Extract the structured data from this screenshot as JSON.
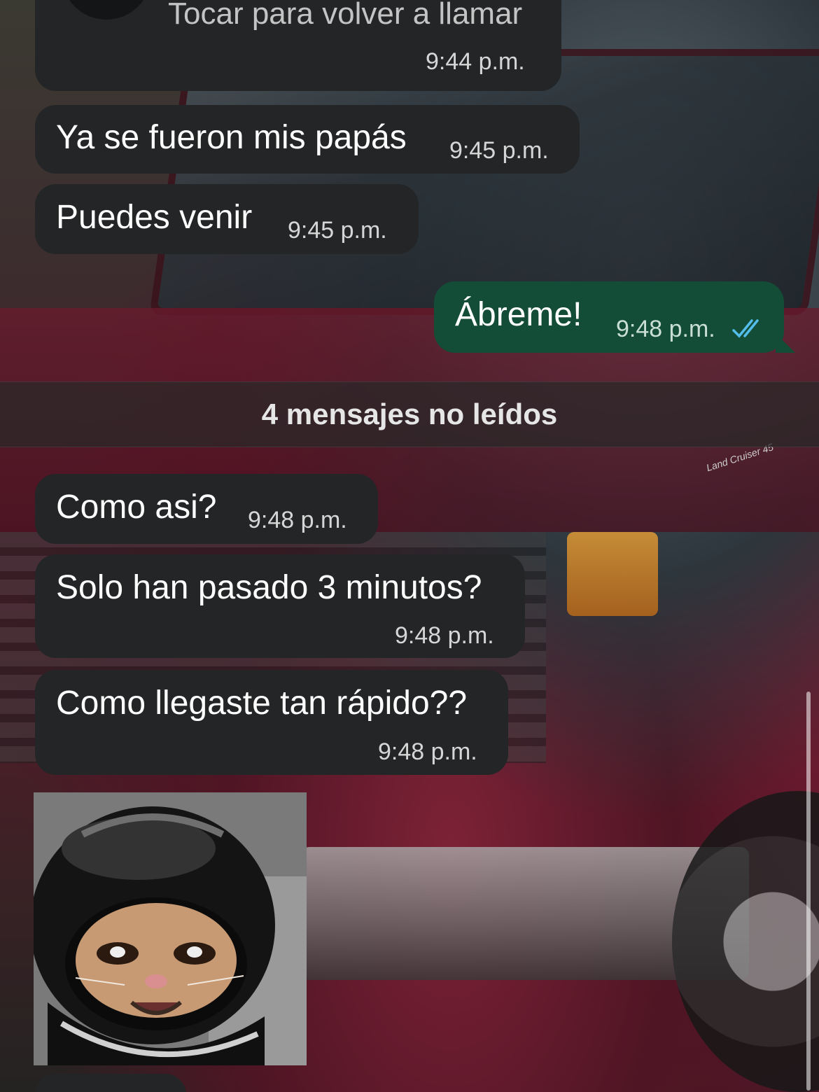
{
  "chat": {
    "call_message": {
      "text": "Tocar para volver a llamar",
      "time": "9:44 p.m.",
      "icon": "missed-call-icon"
    },
    "messages": [
      {
        "text": "Ya se fueron mis papás",
        "time": "9:45 p.m.",
        "direction": "in"
      },
      {
        "text": "Puedes venir",
        "time": "9:45 p.m.",
        "direction": "in"
      },
      {
        "text": "Ábreme!",
        "time": "9:48 p.m.",
        "direction": "out",
        "status": "read"
      },
      {
        "text": "Como asi?",
        "time": "9:48 p.m.",
        "direction": "in"
      },
      {
        "text": "Solo han pasado 3 minutos?",
        "time": "9:48 p.m.",
        "direction": "in"
      },
      {
        "text": "Como llegaste tan rápido??",
        "time": "9:48 p.m.",
        "direction": "in"
      }
    ],
    "unread_banner": "4 mensajes no leídos",
    "sticker": {
      "icon": "cat-in-helmet-sticker"
    },
    "wallpaper": {
      "badge": "Land Cruiser 45"
    }
  },
  "colors": {
    "incoming_bubble": "#232526",
    "outgoing_bubble": "#144d37",
    "read_check": "#53bdeb",
    "missed_call_red": "#f15c6d"
  }
}
